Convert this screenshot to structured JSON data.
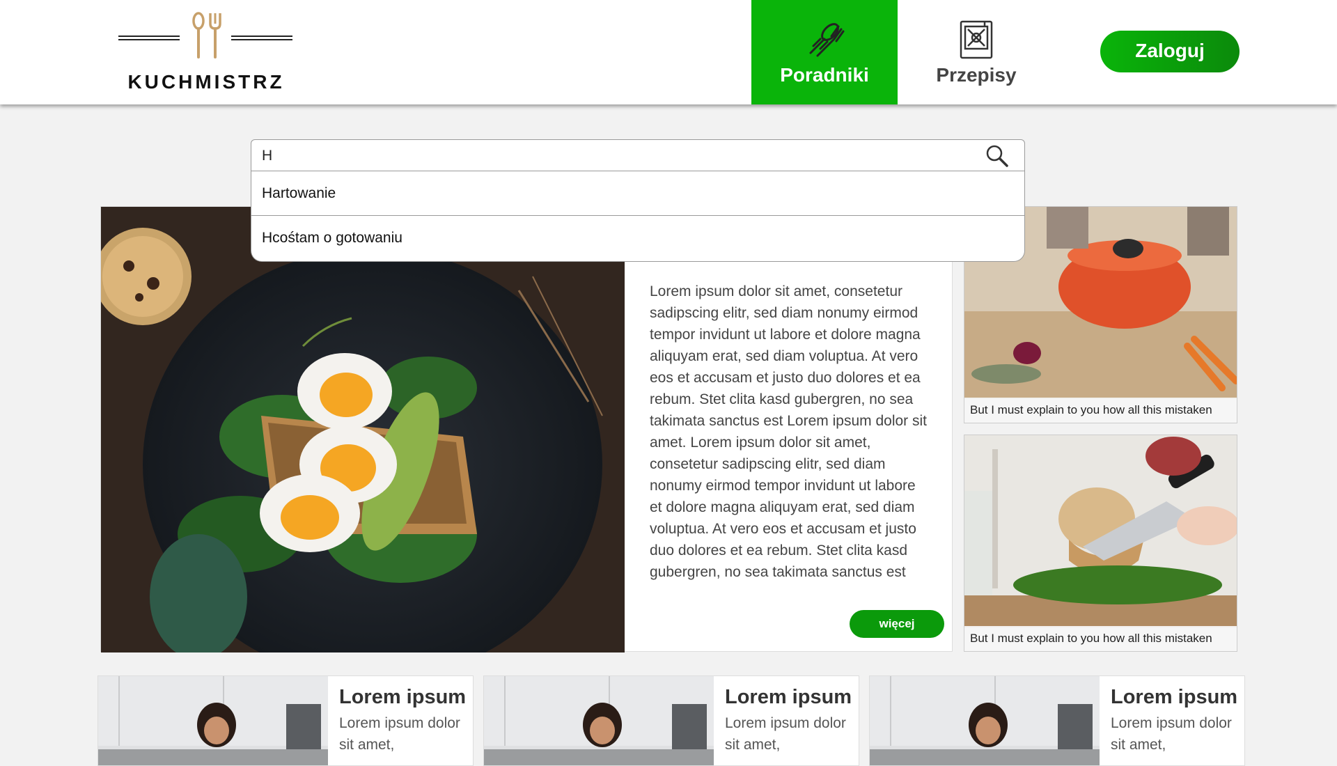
{
  "header": {
    "logo_text": "KUCHMISTRZ",
    "nav": [
      {
        "label": "Poradniki",
        "icon": "whisk-spatula-icon",
        "active": true
      },
      {
        "label": "Przepisy",
        "icon": "recipe-book-icon",
        "active": false
      }
    ],
    "login_label": "Zaloguj"
  },
  "search": {
    "value": "H",
    "suggestions": [
      "Hartowanie",
      "Hcośtam o gotowaniu"
    ]
  },
  "feature": {
    "text": "Lorem ipsum dolor sit amet, consetetur sadipscing elitr, sed diam nonumy eirmod tempor invidunt ut labore et dolore magna aliquyam erat, sed diam voluptua. At vero eos et accusam et justo duo dolores et ea rebum. Stet clita kasd gubergren, no sea takimata sanctus est Lorem ipsum dolor sit amet. Lorem ipsum dolor sit amet, consetetur sadipscing elitr, sed diam nonumy eirmod tempor invidunt ut labore et dolore magna aliquyam erat, sed diam voluptua. At vero eos et accusam et justo duo dolores et ea rebum. Stet clita kasd gubergren, no sea takimata sanctus est",
    "more_label": "więcej"
  },
  "side_cards": [
    {
      "caption": "But I must explain to you how all this mistaken"
    },
    {
      "caption": "But I must explain to you how all this mistaken"
    }
  ],
  "cards": [
    {
      "title": "Lorem ipsum",
      "desc": "Lorem ipsum dolor sit amet,"
    },
    {
      "title": "Lorem ipsum",
      "desc": "Lorem ipsum dolor sit amet,"
    },
    {
      "title": "Lorem ipsum",
      "desc": "Lorem ipsum dolor sit amet,"
    }
  ],
  "colors": {
    "accent": "#0ab40a",
    "logo_gold": "#c7a06a"
  }
}
